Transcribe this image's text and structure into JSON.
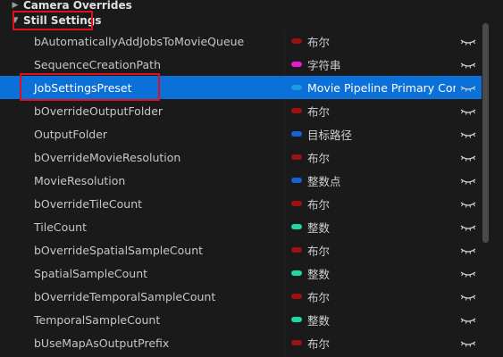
{
  "categories": {
    "camera": "Camera Overrides",
    "still": "Still Settings"
  },
  "rows": [
    {
      "name": "bAutomaticallyAddJobsToMovieQueue",
      "type": "布尔",
      "pin": "#9b1010"
    },
    {
      "name": "SequenceCreationPath",
      "type": "字符串",
      "pin": "#e21ad2"
    },
    {
      "name": "JobSettingsPreset",
      "type": "Movie Pipeline Primary Confi",
      "pin": "#1a9ce6"
    },
    {
      "name": "bOverrideOutputFolder",
      "type": "布尔",
      "pin": "#9b1010"
    },
    {
      "name": "OutputFolder",
      "type": "目标路径",
      "pin": "#1463d2"
    },
    {
      "name": "bOverrideMovieResolution",
      "type": "布尔",
      "pin": "#9b1010"
    },
    {
      "name": "MovieResolution",
      "type": "整数点",
      "pin": "#1463d2"
    },
    {
      "name": "bOverrideTileCount",
      "type": "布尔",
      "pin": "#9b1010"
    },
    {
      "name": "TileCount",
      "type": "整数",
      "pin": "#1fd6a6"
    },
    {
      "name": "bOverrideSpatialSampleCount",
      "type": "布尔",
      "pin": "#9b1010"
    },
    {
      "name": "SpatialSampleCount",
      "type": "整数",
      "pin": "#1fd6a6"
    },
    {
      "name": "bOverrideTemporalSampleCount",
      "type": "布尔",
      "pin": "#9b1010"
    },
    {
      "name": "TemporalSampleCount",
      "type": "整数",
      "pin": "#1fd6a6"
    },
    {
      "name": "bUseMapAsOutputPrefix",
      "type": "布尔",
      "pin": "#9b1010"
    }
  ],
  "selected_row": "JobSettingsPreset",
  "colors": {
    "selection": "#0b70d8",
    "annotation": "#e0101a",
    "background": "#1a1a1a"
  },
  "icons": {
    "visibility": "eye-icon",
    "collapsed": "triangle-right-icon",
    "expanded": "triangle-down-icon"
  }
}
